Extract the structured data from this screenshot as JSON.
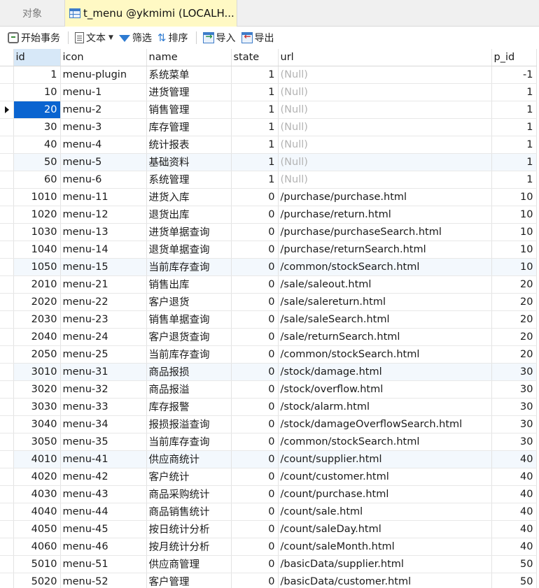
{
  "tabs": {
    "objects_label": "对象",
    "active_label": "t_menu @ykmimi (LOCALH..."
  },
  "toolbar": {
    "begin_transaction": "开始事务",
    "text": "文本",
    "filter": "筛选",
    "sort": "排序",
    "import": "导入",
    "export": "导出"
  },
  "grid": {
    "columns": [
      "id",
      "icon",
      "name",
      "state",
      "url",
      "p_id"
    ],
    "selected_row": 2,
    "null_label": "(Null)",
    "rows": [
      [
        "1",
        "menu-plugin",
        "系统菜单",
        "1",
        "(Null)",
        "-1"
      ],
      [
        "10",
        "menu-1",
        "进货管理",
        "1",
        "(Null)",
        "1"
      ],
      [
        "20",
        "menu-2",
        "销售管理",
        "1",
        "(Null)",
        "1"
      ],
      [
        "30",
        "menu-3",
        "库存管理",
        "1",
        "(Null)",
        "1"
      ],
      [
        "40",
        "menu-4",
        "统计报表",
        "1",
        "(Null)",
        "1"
      ],
      [
        "50",
        "menu-5",
        "基础资料",
        "1",
        "(Null)",
        "1"
      ],
      [
        "60",
        "menu-6",
        "系统管理",
        "1",
        "(Null)",
        "1"
      ],
      [
        "1010",
        "menu-11",
        "进货入库",
        "0",
        "/purchase/purchase.html",
        "10"
      ],
      [
        "1020",
        "menu-12",
        "退货出库",
        "0",
        "/purchase/return.html",
        "10"
      ],
      [
        "1030",
        "menu-13",
        "进货单据查询",
        "0",
        "/purchase/purchaseSearch.html",
        "10"
      ],
      [
        "1040",
        "menu-14",
        "退货单据查询",
        "0",
        "/purchase/returnSearch.html",
        "10"
      ],
      [
        "1050",
        "menu-15",
        "当前库存查询",
        "0",
        "/common/stockSearch.html",
        "10"
      ],
      [
        "2010",
        "menu-21",
        "销售出库",
        "0",
        "/sale/saleout.html",
        "20"
      ],
      [
        "2020",
        "menu-22",
        "客户退货",
        "0",
        "/sale/salereturn.html",
        "20"
      ],
      [
        "2030",
        "menu-23",
        "销售单据查询",
        "0",
        "/sale/saleSearch.html",
        "20"
      ],
      [
        "2040",
        "menu-24",
        "客户退货查询",
        "0",
        "/sale/returnSearch.html",
        "20"
      ],
      [
        "2050",
        "menu-25",
        "当前库存查询",
        "0",
        "/common/stockSearch.html",
        "20"
      ],
      [
        "3010",
        "menu-31",
        "商品报损",
        "0",
        "/stock/damage.html",
        "30"
      ],
      [
        "3020",
        "menu-32",
        "商品报溢",
        "0",
        "/stock/overflow.html",
        "30"
      ],
      [
        "3030",
        "menu-33",
        "库存报警",
        "0",
        "/stock/alarm.html",
        "30"
      ],
      [
        "3040",
        "menu-34",
        "报损报溢查询",
        "0",
        "/stock/damageOverflowSearch.html",
        "30"
      ],
      [
        "3050",
        "menu-35",
        "当前库存查询",
        "0",
        "/common/stockSearch.html",
        "30"
      ],
      [
        "4010",
        "menu-41",
        "供应商统计",
        "0",
        "/count/supplier.html",
        "40"
      ],
      [
        "4020",
        "menu-42",
        "客户统计",
        "0",
        "/count/customer.html",
        "40"
      ],
      [
        "4030",
        "menu-43",
        "商品采购统计",
        "0",
        "/count/purchase.html",
        "40"
      ],
      [
        "4040",
        "menu-44",
        "商品销售统计",
        "0",
        "/count/sale.html",
        "40"
      ],
      [
        "4050",
        "menu-45",
        "按日统计分析",
        "0",
        "/count/saleDay.html",
        "40"
      ],
      [
        "4060",
        "menu-46",
        "按月统计分析",
        "0",
        "/count/saleMonth.html",
        "40"
      ],
      [
        "5010",
        "menu-51",
        "供应商管理",
        "0",
        "/basicData/supplier.html",
        "50"
      ],
      [
        "5020",
        "menu-52",
        "客户管理",
        "0",
        "/basicData/customer.html",
        "50"
      ]
    ]
  },
  "colors": {
    "selection": "#0a64d0",
    "active_tab": "#fff9c4",
    "alt_row": "#f3f8fd",
    "null_text": "#b3b3b3"
  }
}
